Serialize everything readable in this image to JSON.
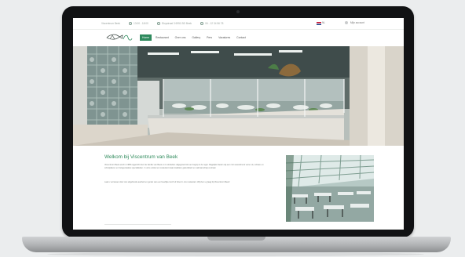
{
  "topbar": {
    "company": "Viscentrum Beek",
    "hours": "13:00 - 18:00",
    "address": "Eloystraat 3 6951 BD Beek",
    "phone": "06 - 12 34 56 78",
    "language": "NL",
    "account_label": "Mijn account"
  },
  "nav": {
    "logo_alt": "Van Beek",
    "items": [
      "Home",
      "Restaurant",
      "Over ons",
      "Gallery",
      "Pers",
      "Vacatures",
      "Contact"
    ]
  },
  "content": {
    "title": "Welkom bij Viscentrum van Beek",
    "paragraph1": "Viscentrum Beek werd in 1985 opgericht door de familie van Beek en is sindsdien uitgegroeid tot een begrip in de regio. Dagelijks bieden wij een ruim assortiment verse vis, schaal- en schelpdieren en huisgemaakte specialiteiten. In onze winkel en restaurant staan kwaliteit, gastvrijheid en vakmanschap centraal.",
    "paragraph2": "Laat u verrassen door ons uitgebreide aanbod en geniet van een heerlijke lunch of diner in ons restaurant. Wij zien u graag bij Viscentrum Beek!"
  },
  "colors": {
    "brand_green": "#2f8a5e"
  }
}
